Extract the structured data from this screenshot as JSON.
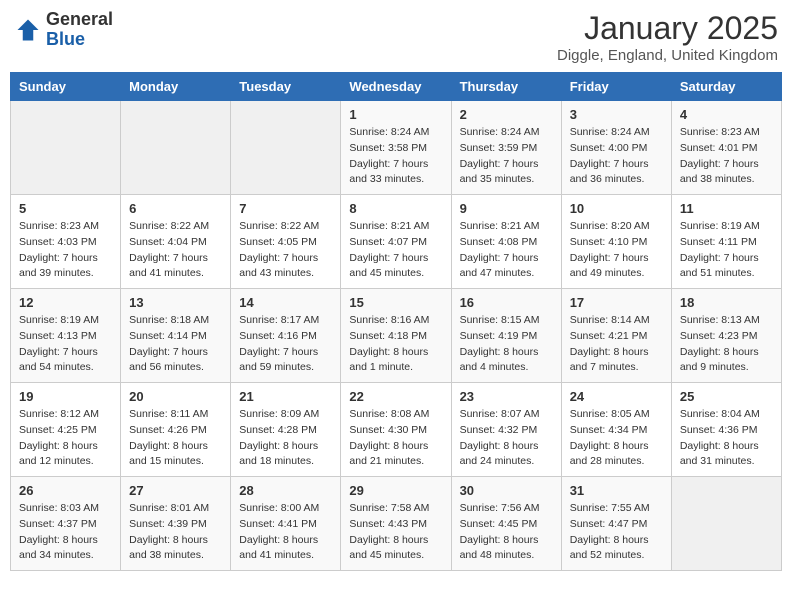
{
  "logo": {
    "general": "General",
    "blue": "Blue"
  },
  "title": "January 2025",
  "location": "Diggle, England, United Kingdom",
  "weekdays": [
    "Sunday",
    "Monday",
    "Tuesday",
    "Wednesday",
    "Thursday",
    "Friday",
    "Saturday"
  ],
  "weeks": [
    [
      {
        "day": "",
        "info": ""
      },
      {
        "day": "",
        "info": ""
      },
      {
        "day": "",
        "info": ""
      },
      {
        "day": "1",
        "info": "Sunrise: 8:24 AM\nSunset: 3:58 PM\nDaylight: 7 hours\nand 33 minutes."
      },
      {
        "day": "2",
        "info": "Sunrise: 8:24 AM\nSunset: 3:59 PM\nDaylight: 7 hours\nand 35 minutes."
      },
      {
        "day": "3",
        "info": "Sunrise: 8:24 AM\nSunset: 4:00 PM\nDaylight: 7 hours\nand 36 minutes."
      },
      {
        "day": "4",
        "info": "Sunrise: 8:23 AM\nSunset: 4:01 PM\nDaylight: 7 hours\nand 38 minutes."
      }
    ],
    [
      {
        "day": "5",
        "info": "Sunrise: 8:23 AM\nSunset: 4:03 PM\nDaylight: 7 hours\nand 39 minutes."
      },
      {
        "day": "6",
        "info": "Sunrise: 8:22 AM\nSunset: 4:04 PM\nDaylight: 7 hours\nand 41 minutes."
      },
      {
        "day": "7",
        "info": "Sunrise: 8:22 AM\nSunset: 4:05 PM\nDaylight: 7 hours\nand 43 minutes."
      },
      {
        "day": "8",
        "info": "Sunrise: 8:21 AM\nSunset: 4:07 PM\nDaylight: 7 hours\nand 45 minutes."
      },
      {
        "day": "9",
        "info": "Sunrise: 8:21 AM\nSunset: 4:08 PM\nDaylight: 7 hours\nand 47 minutes."
      },
      {
        "day": "10",
        "info": "Sunrise: 8:20 AM\nSunset: 4:10 PM\nDaylight: 7 hours\nand 49 minutes."
      },
      {
        "day": "11",
        "info": "Sunrise: 8:19 AM\nSunset: 4:11 PM\nDaylight: 7 hours\nand 51 minutes."
      }
    ],
    [
      {
        "day": "12",
        "info": "Sunrise: 8:19 AM\nSunset: 4:13 PM\nDaylight: 7 hours\nand 54 minutes."
      },
      {
        "day": "13",
        "info": "Sunrise: 8:18 AM\nSunset: 4:14 PM\nDaylight: 7 hours\nand 56 minutes."
      },
      {
        "day": "14",
        "info": "Sunrise: 8:17 AM\nSunset: 4:16 PM\nDaylight: 7 hours\nand 59 minutes."
      },
      {
        "day": "15",
        "info": "Sunrise: 8:16 AM\nSunset: 4:18 PM\nDaylight: 8 hours\nand 1 minute."
      },
      {
        "day": "16",
        "info": "Sunrise: 8:15 AM\nSunset: 4:19 PM\nDaylight: 8 hours\nand 4 minutes."
      },
      {
        "day": "17",
        "info": "Sunrise: 8:14 AM\nSunset: 4:21 PM\nDaylight: 8 hours\nand 7 minutes."
      },
      {
        "day": "18",
        "info": "Sunrise: 8:13 AM\nSunset: 4:23 PM\nDaylight: 8 hours\nand 9 minutes."
      }
    ],
    [
      {
        "day": "19",
        "info": "Sunrise: 8:12 AM\nSunset: 4:25 PM\nDaylight: 8 hours\nand 12 minutes."
      },
      {
        "day": "20",
        "info": "Sunrise: 8:11 AM\nSunset: 4:26 PM\nDaylight: 8 hours\nand 15 minutes."
      },
      {
        "day": "21",
        "info": "Sunrise: 8:09 AM\nSunset: 4:28 PM\nDaylight: 8 hours\nand 18 minutes."
      },
      {
        "day": "22",
        "info": "Sunrise: 8:08 AM\nSunset: 4:30 PM\nDaylight: 8 hours\nand 21 minutes."
      },
      {
        "day": "23",
        "info": "Sunrise: 8:07 AM\nSunset: 4:32 PM\nDaylight: 8 hours\nand 24 minutes."
      },
      {
        "day": "24",
        "info": "Sunrise: 8:05 AM\nSunset: 4:34 PM\nDaylight: 8 hours\nand 28 minutes."
      },
      {
        "day": "25",
        "info": "Sunrise: 8:04 AM\nSunset: 4:36 PM\nDaylight: 8 hours\nand 31 minutes."
      }
    ],
    [
      {
        "day": "26",
        "info": "Sunrise: 8:03 AM\nSunset: 4:37 PM\nDaylight: 8 hours\nand 34 minutes."
      },
      {
        "day": "27",
        "info": "Sunrise: 8:01 AM\nSunset: 4:39 PM\nDaylight: 8 hours\nand 38 minutes."
      },
      {
        "day": "28",
        "info": "Sunrise: 8:00 AM\nSunset: 4:41 PM\nDaylight: 8 hours\nand 41 minutes."
      },
      {
        "day": "29",
        "info": "Sunrise: 7:58 AM\nSunset: 4:43 PM\nDaylight: 8 hours\nand 45 minutes."
      },
      {
        "day": "30",
        "info": "Sunrise: 7:56 AM\nSunset: 4:45 PM\nDaylight: 8 hours\nand 48 minutes."
      },
      {
        "day": "31",
        "info": "Sunrise: 7:55 AM\nSunset: 4:47 PM\nDaylight: 8 hours\nand 52 minutes."
      },
      {
        "day": "",
        "info": ""
      }
    ]
  ]
}
